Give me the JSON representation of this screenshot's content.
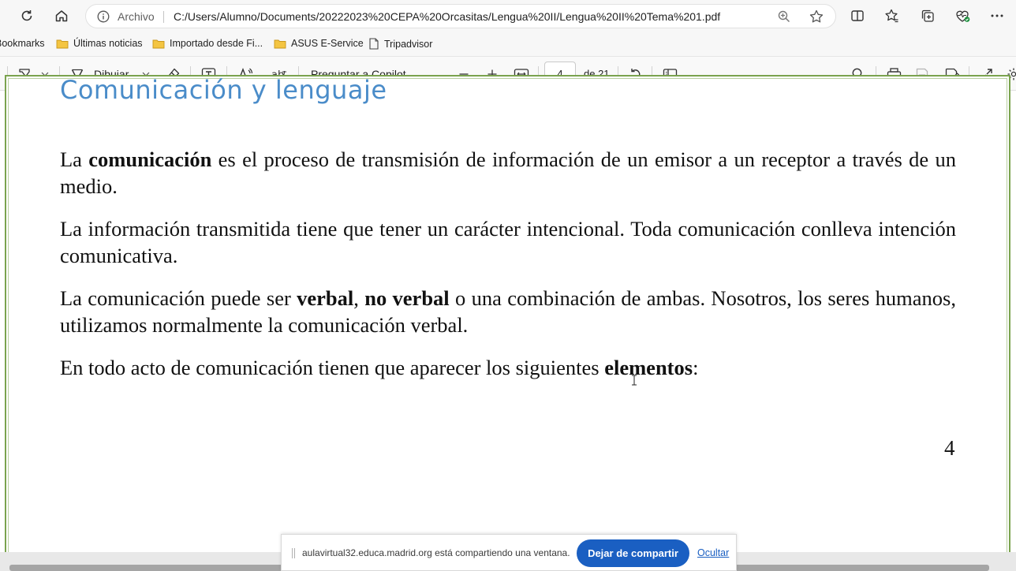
{
  "browser": {
    "protocol_label": "Archivo",
    "url": "C:/Users/Alumno/Documents/20222023%20CEPA%20Orcasitas/Lengua%20II/Lengua%20II%20Tema%201.pdf"
  },
  "bookmarks": {
    "items": [
      {
        "label": "Bookmarks",
        "icon": "none"
      },
      {
        "label": "Últimas noticias",
        "icon": "folder-icon"
      },
      {
        "label": "Importado desde Fi...",
        "icon": "folder-icon"
      },
      {
        "label": "ASUS E-Service",
        "icon": "folder-icon"
      },
      {
        "label": "Tripadvisor",
        "icon": "page-icon"
      }
    ]
  },
  "pdf_toolbar": {
    "draw_label": "Dibujar",
    "copilot_label": "Preguntar a Copilot",
    "current_page": "4",
    "total_pages": "de 21"
  },
  "document": {
    "heading": "Comunicación y lenguaje",
    "paragraphs": [
      {
        "parts": [
          {
            "text": "La ",
            "bold": false
          },
          {
            "text": "comunicación",
            "bold": true
          },
          {
            "text": " es el proceso de transmisión de información de un emisor a un receptor a través de un medio.",
            "bold": false
          }
        ]
      },
      {
        "parts": [
          {
            "text": "La información transmitida tiene que tener un carácter intencional. Toda comunicación conlleva intención comunicativa.",
            "bold": false
          }
        ]
      },
      {
        "parts": [
          {
            "text": "La comunicación puede ser ",
            "bold": false
          },
          {
            "text": "verbal",
            "bold": true
          },
          {
            "text": ", ",
            "bold": false
          },
          {
            "text": "no verbal",
            "bold": true
          },
          {
            "text": " o una combinación de ambas. Nosotros, los seres humanos, utilizamos normalmente la comunicación verbal.",
            "bold": false
          }
        ]
      },
      {
        "parts": [
          {
            "text": "En todo acto de comunicación tienen que aparecer los siguientes ",
            "bold": false
          },
          {
            "text": "elementos",
            "bold": true
          },
          {
            "text": ":",
            "bold": false
          }
        ]
      }
    ],
    "page_number": "4"
  },
  "share_bar": {
    "message": "aulavirtual32.educa.madrid.org está compartiendo una ventana.",
    "stop_label": "Dejar de compartir",
    "hide_label": "Ocultar"
  },
  "colors": {
    "heading": "#4a8cc9",
    "page_border": "#7aa34e",
    "share_button": "#1a5fc2"
  }
}
